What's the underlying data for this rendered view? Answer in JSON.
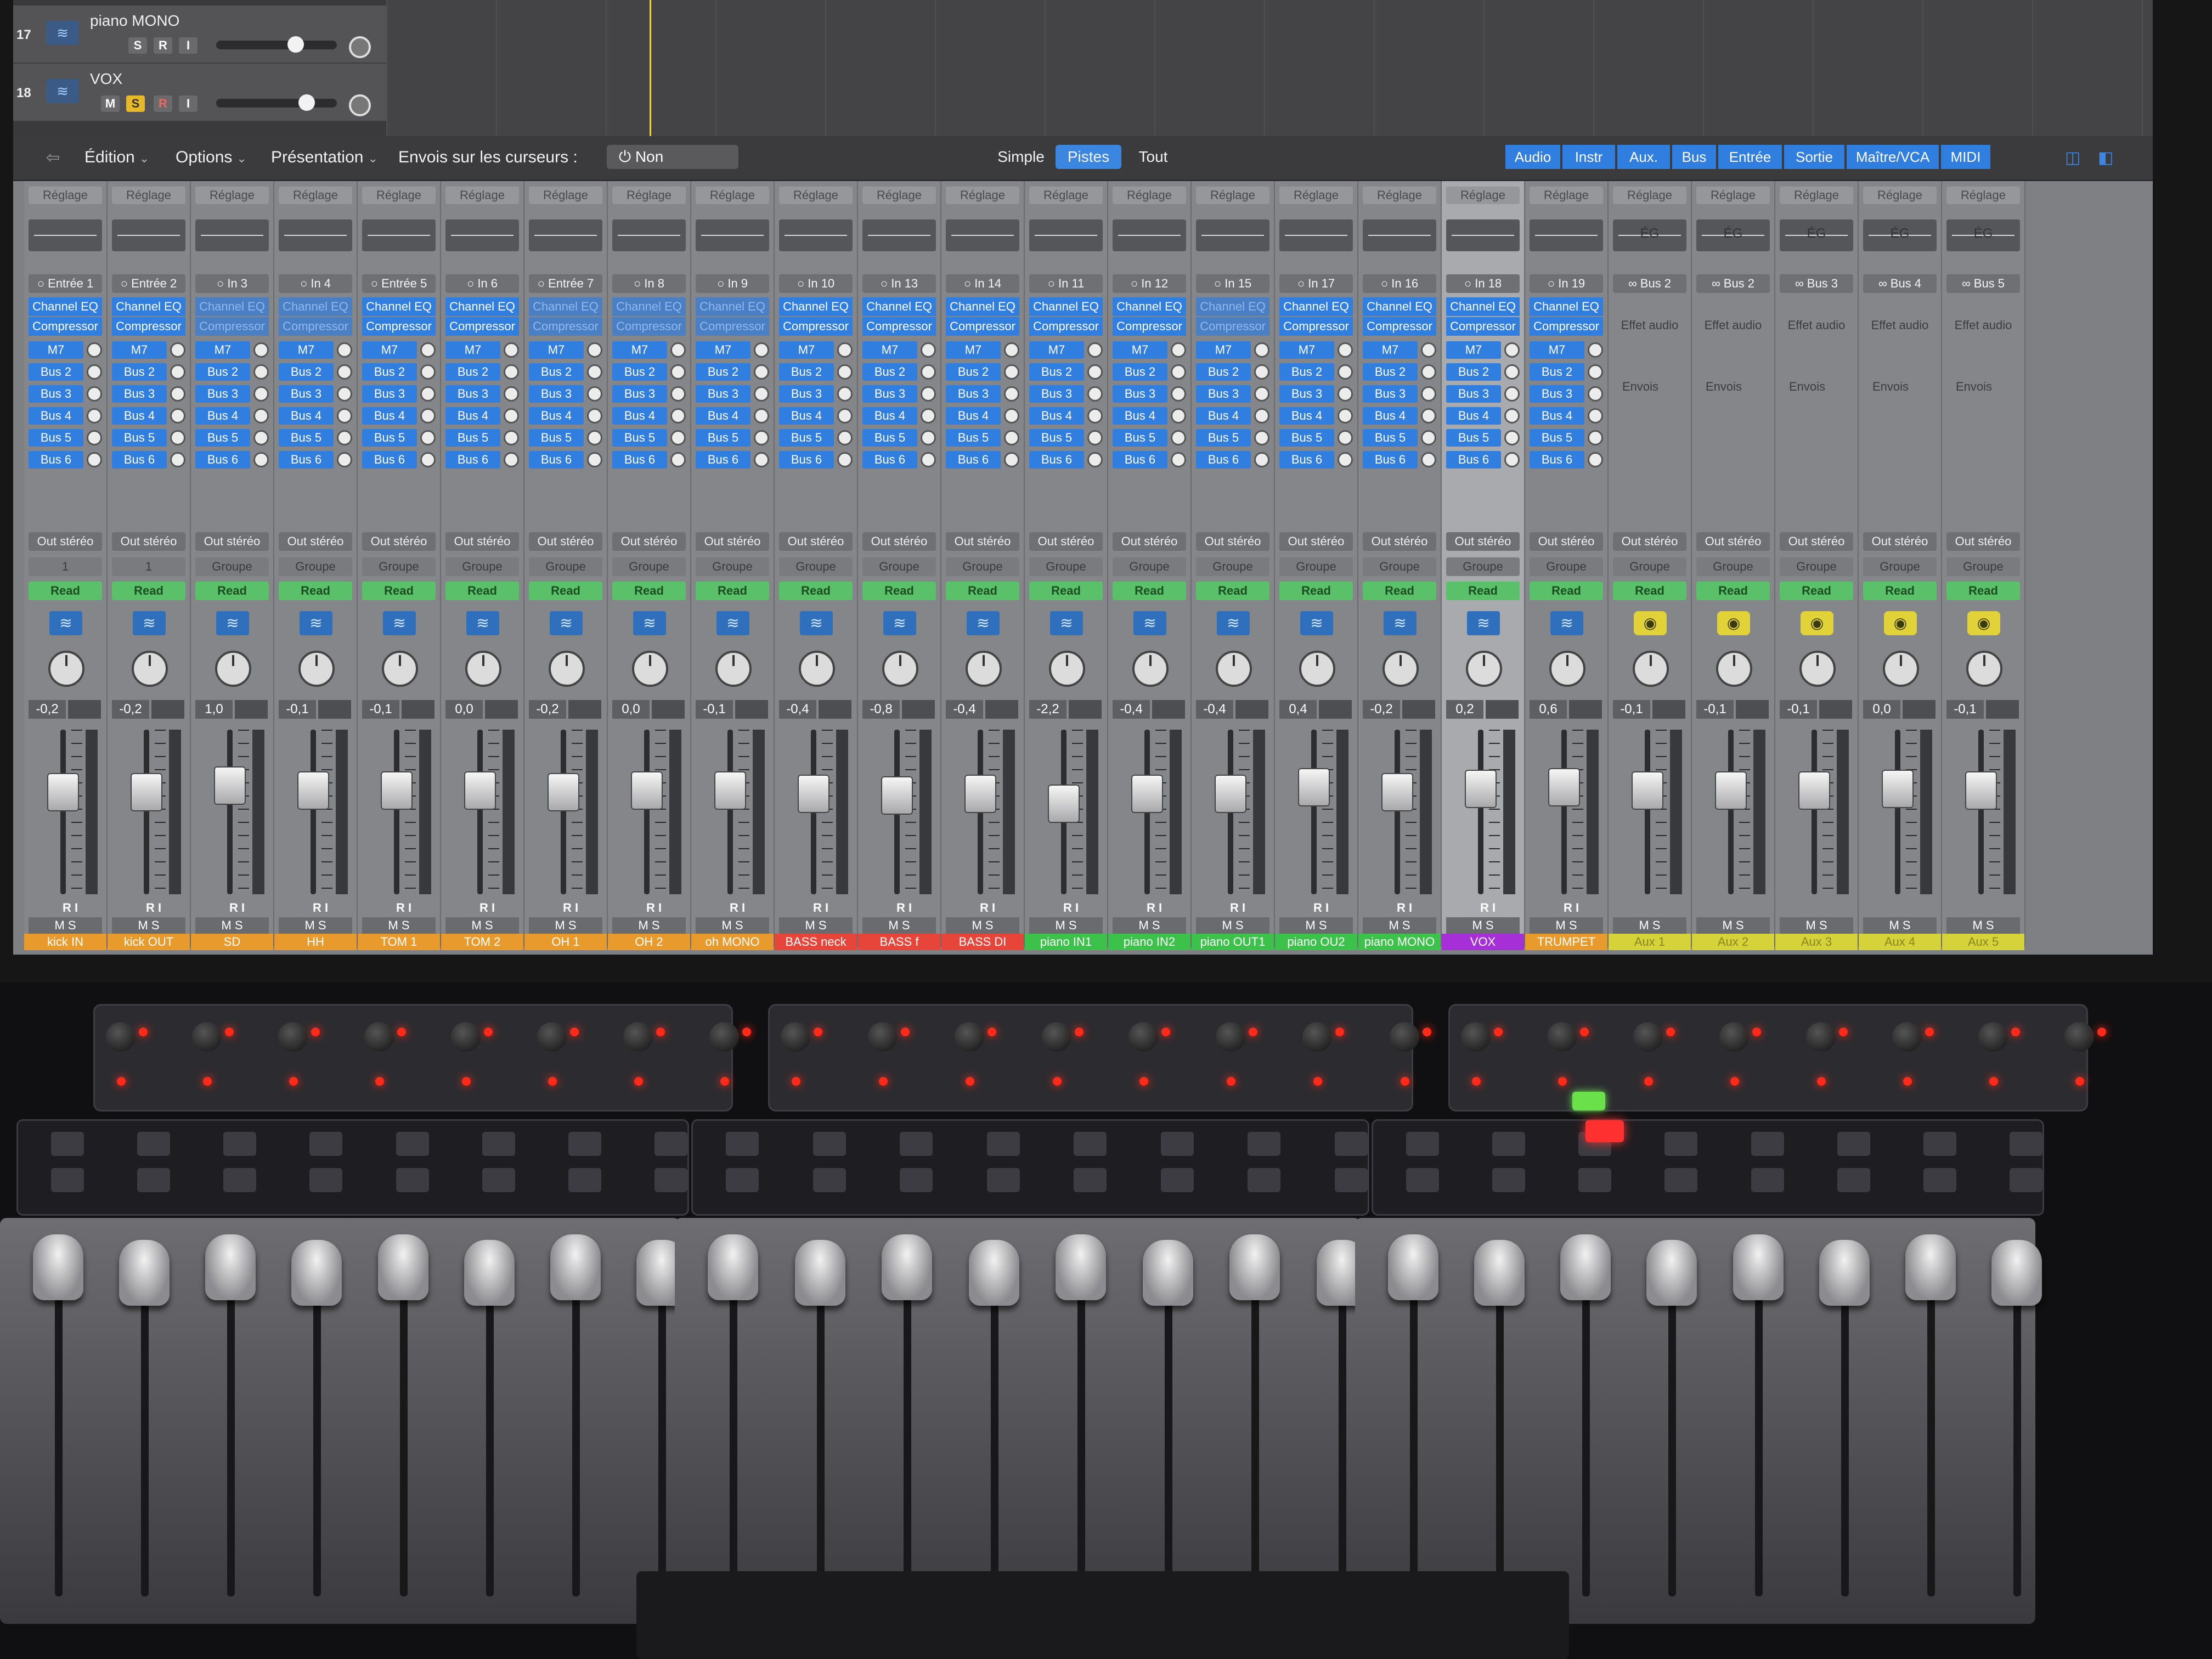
{
  "tracks": [
    {
      "num": "17",
      "name": "piano MONO",
      "buttons": [
        "S",
        "R",
        "I"
      ]
    },
    {
      "num": "18",
      "name": "VOX",
      "buttons": [
        "M",
        "S",
        "R",
        "I"
      ]
    }
  ],
  "toolbar": {
    "edition": "Édition",
    "options": "Options",
    "presentation": "Présentation",
    "sends_label": "Envois sur les curseurs :",
    "sends_value": "Non",
    "view_simple": "Simple",
    "view_pistes": "Pistes",
    "view_tout": "Tout",
    "filters": [
      "Audio",
      "Instr",
      "Aux.",
      "Bus",
      "Entrée",
      "Sortie",
      "Maître/VCA",
      "MIDI"
    ]
  },
  "strips": [
    {
      "setting": "Réglage",
      "input": "Entrée 1",
      "plugins": [
        "Channel EQ",
        "Compressor"
      ],
      "out": "Out stéréo",
      "group": "1",
      "vol": "-0,2",
      "name": "kick IN",
      "color": "#e99a2c",
      "level": 0.62
    },
    {
      "setting": "Réglage",
      "input": "Entrée 2",
      "plugins": [
        "Channel EQ",
        "Compressor"
      ],
      "out": "Out stéréo",
      "group": "1",
      "vol": "-0,2",
      "name": "kick OUT",
      "color": "#e99a2c",
      "level": 0.62
    },
    {
      "setting": "Réglage",
      "input": "In 3",
      "plugins": [
        "Channel EQ",
        "Compressor"
      ],
      "out": "Out stéréo",
      "group": "Groupe",
      "vol": "1,0",
      "name": "SD",
      "color": "#e99a2c",
      "level": 0.66
    },
    {
      "setting": "Réglage",
      "input": "In 4",
      "plugins": [
        "Channel EQ",
        "Compressor"
      ],
      "out": "Out stéréo",
      "group": "Groupe",
      "vol": "-0,1",
      "name": "HH",
      "color": "#e99a2c",
      "level": 0.63
    },
    {
      "setting": "Réglage",
      "input": "Entrée 5",
      "plugins": [
        "Channel EQ",
        "Compressor"
      ],
      "out": "Out stéréo",
      "group": "Groupe",
      "vol": "-0,1",
      "name": "TOM 1",
      "color": "#e99a2c",
      "level": 0.63
    },
    {
      "setting": "Réglage",
      "input": "In 6",
      "plugins": [
        "Channel EQ",
        "Compressor"
      ],
      "out": "Out stéréo",
      "group": "Groupe",
      "vol": "0,0",
      "name": "TOM 2",
      "color": "#e99a2c",
      "level": 0.63
    },
    {
      "setting": "Réglage",
      "input": "Entrée 7",
      "plugins": [
        "Channel EQ",
        "Compressor"
      ],
      "out": "Out stéréo",
      "group": "Groupe",
      "vol": "-0,2",
      "name": "OH 1",
      "color": "#e99a2c",
      "level": 0.62
    },
    {
      "setting": "Réglage",
      "input": "In 8",
      "plugins": [
        "Channel EQ",
        "Compressor"
      ],
      "out": "Out stéréo",
      "group": "Groupe",
      "vol": "0,0",
      "name": "OH 2",
      "color": "#e99a2c",
      "level": 0.63
    },
    {
      "setting": "Réglage",
      "input": "In 9",
      "plugins": [
        "Channel EQ",
        "Compressor"
      ],
      "out": "Out stéréo",
      "group": "Groupe",
      "vol": "-0,1",
      "name": "oh MONO",
      "color": "#e99a2c",
      "level": 0.63
    },
    {
      "setting": "Réglage",
      "input": "In 10",
      "plugins": [
        "Channel EQ",
        "Compressor"
      ],
      "out": "Out stéréo",
      "group": "Groupe",
      "vol": "-0,4",
      "name": "BASS neck",
      "color": "#e8453a",
      "level": 0.61
    },
    {
      "setting": "Réglage",
      "input": "In 13",
      "plugins": [
        "Channel EQ",
        "Compressor"
      ],
      "out": "Out stéréo",
      "group": "Groupe",
      "vol": "-0,8",
      "name": "BASS f",
      "color": "#e8453a",
      "level": 0.6
    },
    {
      "setting": "Réglage",
      "input": "In 14",
      "plugins": [
        "Channel EQ",
        "Compressor"
      ],
      "out": "Out stéréo",
      "group": "Groupe",
      "vol": "-0,4",
      "name": "BASS DI",
      "color": "#e8453a",
      "level": 0.61
    },
    {
      "setting": "Réglage",
      "input": "In 11",
      "plugins": [
        "Channel EQ",
        "Compressor"
      ],
      "out": "Out stéréo",
      "group": "Groupe",
      "vol": "-2,2",
      "name": "piano IN1",
      "color": "#3cc24a",
      "level": 0.55
    },
    {
      "setting": "Réglage",
      "input": "In 12",
      "plugins": [
        "Channel EQ",
        "Compressor"
      ],
      "out": "Out stéréo",
      "group": "Groupe",
      "vol": "-0,4",
      "name": "piano IN2",
      "color": "#3cc24a",
      "level": 0.61
    },
    {
      "setting": "Réglage",
      "input": "In 15",
      "plugins": [
        "Channel EQ",
        "Compressor"
      ],
      "out": "Out stéréo",
      "group": "Groupe",
      "vol": "-0,4",
      "name": "piano OUT1",
      "color": "#3cc24a",
      "level": 0.61
    },
    {
      "setting": "Réglage",
      "input": "In 17",
      "plugins": [
        "Channel EQ",
        "Compressor"
      ],
      "out": "Out stéréo",
      "group": "Groupe",
      "vol": "0,4",
      "name": "piano OU2",
      "color": "#3cc24a",
      "level": 0.65
    },
    {
      "setting": "Réglage",
      "input": "In 16",
      "plugins": [
        "Channel EQ",
        "Compressor"
      ],
      "out": "Out stéréo",
      "group": "Groupe",
      "vol": "-0,2",
      "name": "piano MONO",
      "color": "#3cc24a",
      "level": 0.62
    },
    {
      "setting": "Réglage",
      "input": "In 18",
      "plugins": [
        "Channel EQ",
        "Compressor"
      ],
      "out": "Out stéréo",
      "group": "Groupe",
      "vol": "0,2",
      "name": "VOX",
      "color": "#a72fd8",
      "level": 0.64,
      "selected": true
    },
    {
      "setting": "Réglage",
      "input": "In 19",
      "plugins": [
        "Channel EQ",
        "Compressor"
      ],
      "out": "Out stéréo",
      "group": "Groupe",
      "vol": "0,6",
      "name": "TRUMPET",
      "color": "#e99a2c",
      "level": 0.65
    }
  ],
  "aux_strips": [
    {
      "setting": "Réglage",
      "eq": "ÉG",
      "input": "Bus 2",
      "fx": "Effet audio",
      "sends": "Envois",
      "out": "Out stéréo",
      "group": "Groupe",
      "vol": "-0,1",
      "name": "Aux 1",
      "level": 0.63
    },
    {
      "setting": "Réglage",
      "eq": "ÉG",
      "input": "Bus 2",
      "fx": "Effet audio",
      "sends": "Envois",
      "out": "Out stéréo",
      "group": "Groupe",
      "vol": "-0,1",
      "name": "Aux 2",
      "level": 0.63
    },
    {
      "setting": "Réglage",
      "eq": "ÉG",
      "input": "Bus 3",
      "fx": "Effet audio",
      "sends": "Envois",
      "out": "Out stéréo",
      "group": "Groupe",
      "vol": "-0,1",
      "name": "Aux 3",
      "level": 0.63
    },
    {
      "setting": "Réglage",
      "eq": "ÉG",
      "input": "Bus 4",
      "fx": "Effet audio",
      "sends": "Envois",
      "out": "Out stéréo",
      "group": "Groupe",
      "vol": "0,0",
      "name": "Aux 4",
      "level": 0.64
    },
    {
      "setting": "Réglage",
      "eq": "ÉG",
      "input": "Bus 5",
      "fx": "Effet audio",
      "sends": "Envois",
      "out": "Out stéréo",
      "group": "Groupe",
      "vol": "-0,1",
      "name": "Aux 5",
      "level": 0.63
    }
  ],
  "sends": [
    "M7",
    "Bus 2",
    "Bus 3",
    "Bus 4",
    "Bus 5",
    "Bus 6"
  ],
  "strip_labels": {
    "read": "Read",
    "ri": "R I",
    "ms": "M  S",
    "aux_color": "#d6d23a"
  },
  "hardware": {
    "rec_led": "REC"
  }
}
